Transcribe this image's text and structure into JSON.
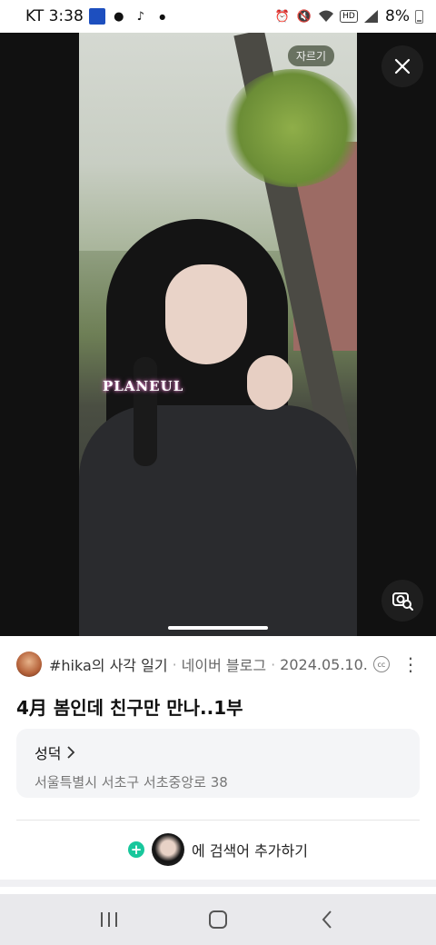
{
  "status_bar": {
    "carrier_time": "KT 3:38",
    "battery": "8%",
    "icons": [
      "app-icon",
      "notification-icon",
      "tiktok-icon",
      "dot-icon",
      "alarm-icon",
      "mute-icon",
      "wifi-icon",
      "hd-icon",
      "signal-icon",
      "battery-icon"
    ]
  },
  "viewer": {
    "crop_label": "자르기",
    "mic_text": "PLANEUL"
  },
  "result": {
    "source_name": "#hika의 사각 일기",
    "source_site": "네이버 블로그",
    "date": "2024.05.10.",
    "title": "4月 봄인데 친구만 만나..1부"
  },
  "place": {
    "name": "성덕",
    "address": "서울특별시 서초구 서초중앙로 38"
  },
  "add_search": {
    "label": "에 검색어 추가하기"
  },
  "colors": {
    "accent": "#18c79c",
    "card_bg": "#f4f5f7"
  }
}
